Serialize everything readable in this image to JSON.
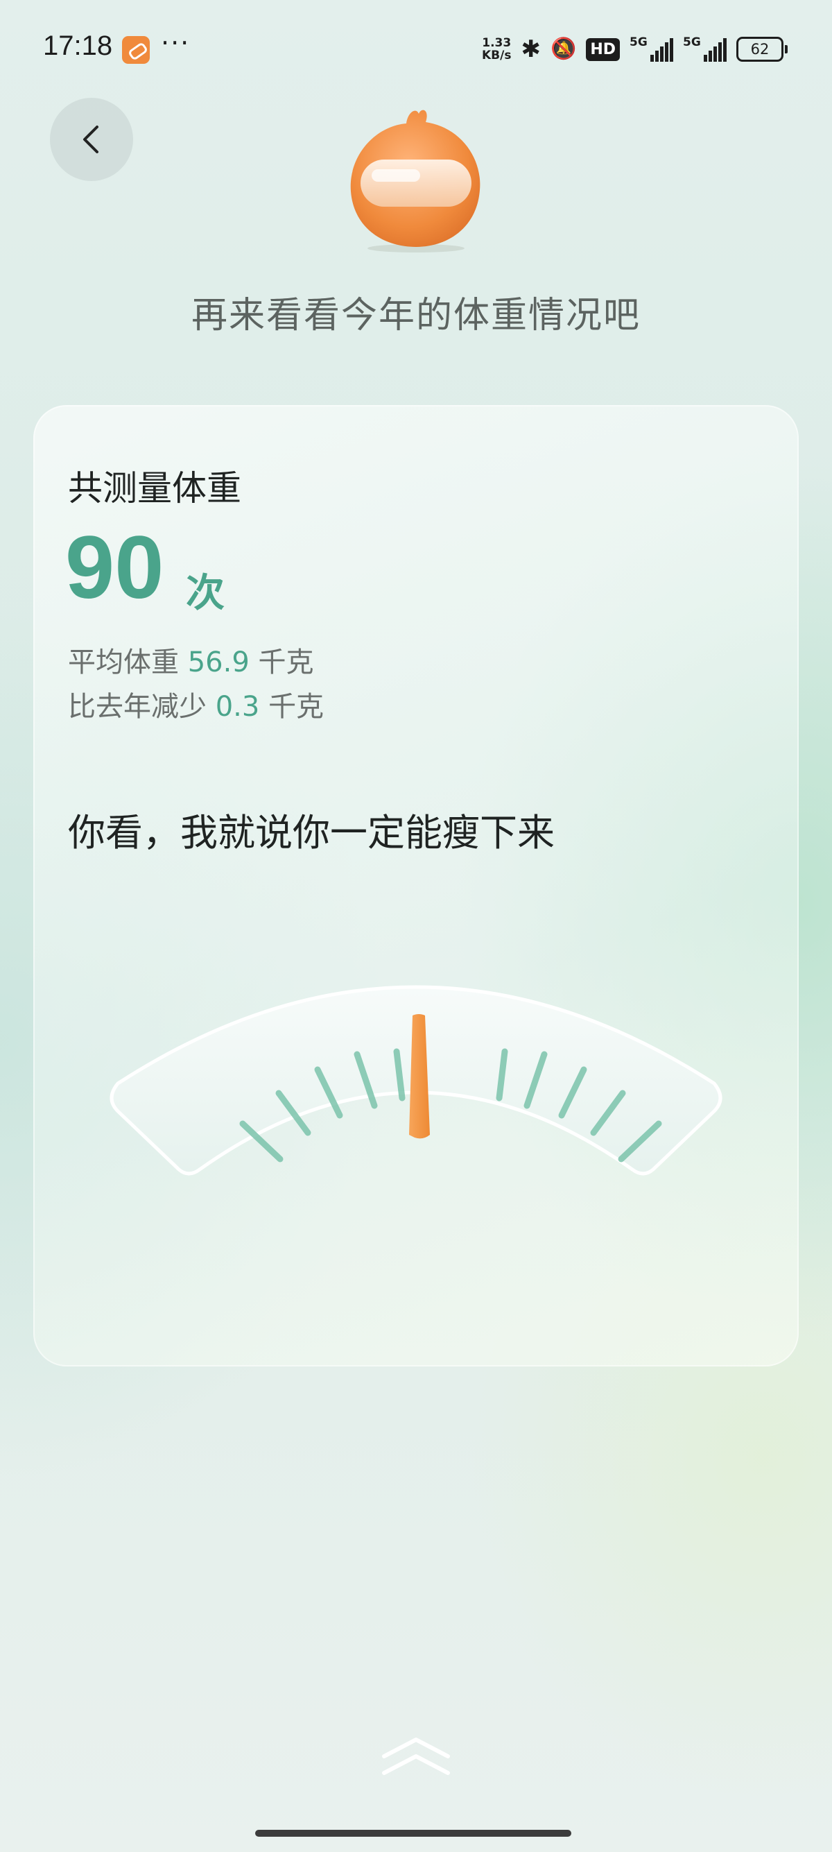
{
  "status_bar": {
    "time": "17:18",
    "more": "···",
    "net_speed_value": "1.33",
    "net_speed_unit": "KB/s",
    "bluetooth_glyph": "✱",
    "silent_glyph": "🔕",
    "hd": "HD",
    "sim1": "5G",
    "sim2": "5G",
    "battery": "62"
  },
  "header": {
    "headline": "再来看看今年的体重情况吧"
  },
  "card": {
    "label": "共测量体重",
    "count": "90",
    "count_unit": "次",
    "avg_label": "平均体重",
    "avg_value": "56.9",
    "avg_unit": "千克",
    "diff_label": "比去年减少",
    "diff_value": "0.3",
    "diff_unit": "千克",
    "encouragement": "你看，我就说你一定能瘦下来"
  },
  "colors": {
    "accent": "#4aa48b",
    "pointer": "#f0913e",
    "mascot": "#f08a3c"
  },
  "icons": {
    "back": "chevron-left-icon",
    "swipe": "double-chevron-up-icon"
  }
}
